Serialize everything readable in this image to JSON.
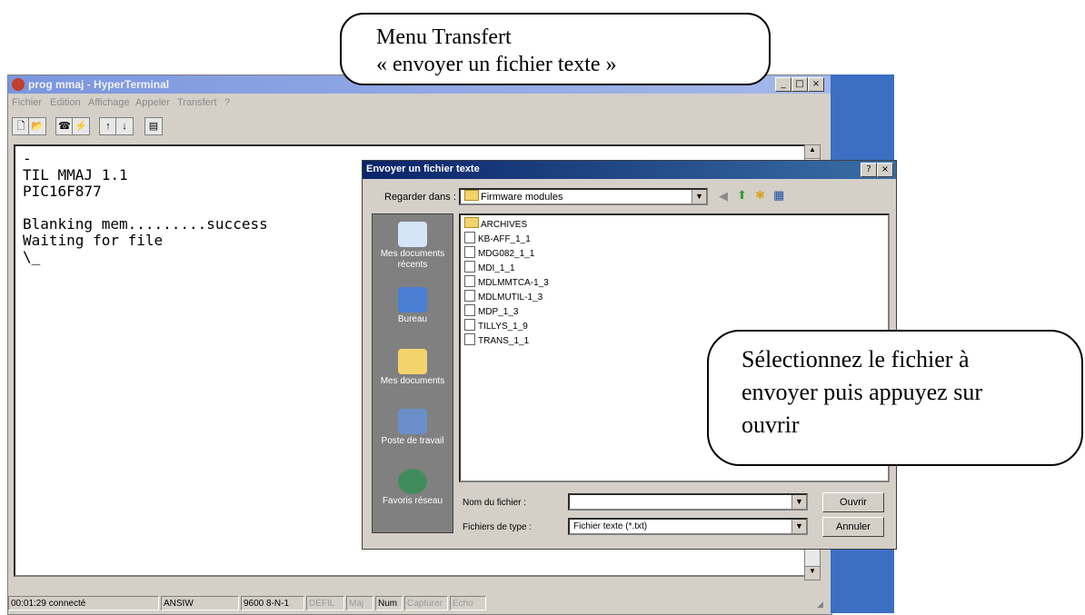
{
  "window": {
    "title": "prog mmaj - HyperTerminal",
    "menu": [
      "Fichier",
      "Edition",
      "Affichage",
      "Appeler",
      "Transfert",
      "?"
    ]
  },
  "terminal": {
    "lines": [
      "-",
      "TIL MMAJ 1.1",
      "PIC16F877",
      "",
      "Blanking mem.........success",
      "Waiting for file",
      "\\_"
    ]
  },
  "statusbar": {
    "time": "00:01:29 connecté",
    "emulation": "ANSIW",
    "settings": "9600 8-N-1",
    "defil": "DÉFIL",
    "maj": "Maj",
    "num": "Num",
    "capturer": "Capturer",
    "echo": "Écho"
  },
  "dialog": {
    "title": "Envoyer un fichier texte",
    "help": "?",
    "lookin_label": "Regarder dans :",
    "lookin_value": "Firmware modules",
    "places": [
      "Mes documents récents",
      "Bureau",
      "Mes documents",
      "Poste de travail",
      "Favoris réseau"
    ],
    "files": [
      {
        "name": "ARCHIVES",
        "type": "folder"
      },
      {
        "name": "KB-AFF_1_1",
        "type": "file"
      },
      {
        "name": "MDG082_1_1",
        "type": "file"
      },
      {
        "name": "MDI_1_1",
        "type": "file"
      },
      {
        "name": "MDLMMTCA-1_3",
        "type": "file"
      },
      {
        "name": "MDLMUTIL-1_3",
        "type": "file"
      },
      {
        "name": "MDP_1_3",
        "type": "file"
      },
      {
        "name": "TILLYS_1_9",
        "type": "file"
      },
      {
        "name": "TRANS_1_1",
        "type": "file"
      }
    ],
    "filename_label": "Nom du fichier :",
    "filename_value": "",
    "filetype_label": "Fichiers de type :",
    "filetype_value": "Fichier texte (*.txt)",
    "open_button": "Ouvrir",
    "cancel_button": "Annuler"
  },
  "callouts": {
    "menu_line1": "Menu Transfert",
    "menu_line2": "« envoyer un fichier texte »",
    "select_line1": "Sélectionnez le fichier à",
    "select_line2": "envoyer puis appuyez sur",
    "select_line3": "ouvrir"
  }
}
